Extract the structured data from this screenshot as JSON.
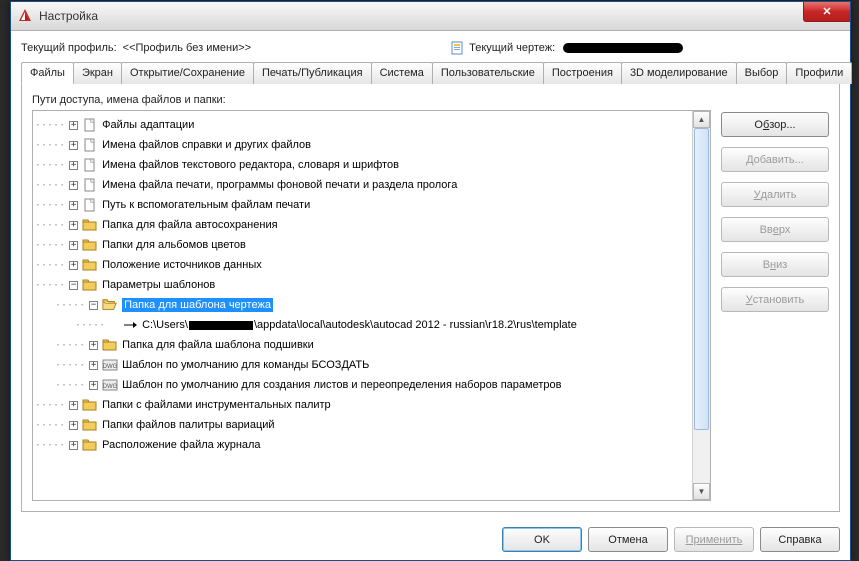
{
  "window": {
    "title": "Настройка",
    "close_x": "✕"
  },
  "profile": {
    "label": "Текущий профиль:",
    "value": "<<Профиль без имени>>",
    "drawing_label": "Текущий чертеж:"
  },
  "tabs": [
    "Файлы",
    "Экран",
    "Открытие/Сохранение",
    "Печать/Публикация",
    "Система",
    "Пользовательские",
    "Построения",
    "3D моделирование",
    "Выбор",
    "Профили"
  ],
  "active_tab_index": 0,
  "section_label": "Пути доступа, имена файлов и папки:",
  "tree": [
    {
      "indent": 0,
      "pm": "+",
      "icon": "doc",
      "label": "Файлы адаптации"
    },
    {
      "indent": 0,
      "pm": "+",
      "icon": "doc",
      "label": "Имена файлов справки и других файлов"
    },
    {
      "indent": 0,
      "pm": "+",
      "icon": "doc",
      "label": "Имена файлов текстового редактора, словаря и шрифтов"
    },
    {
      "indent": 0,
      "pm": "+",
      "icon": "doc",
      "label": "Имена файла печати, программы фоновой печати и раздела пролога"
    },
    {
      "indent": 0,
      "pm": "+",
      "icon": "doc",
      "label": "Путь к вспомогательным файлам печати"
    },
    {
      "indent": 0,
      "pm": "+",
      "icon": "folder",
      "label": "Папка для файла автосохранения"
    },
    {
      "indent": 0,
      "pm": "+",
      "icon": "folder",
      "label": "Папки для альбомов цветов"
    },
    {
      "indent": 0,
      "pm": "+",
      "icon": "folder",
      "label": "Положение источников данных"
    },
    {
      "indent": 0,
      "pm": "-",
      "icon": "folder",
      "label": "Параметры шаблонов"
    },
    {
      "indent": 1,
      "pm": "-",
      "icon": "folder-open",
      "label": "Папка для шаблона чертежа",
      "selected": true
    },
    {
      "indent": 2,
      "pm": "",
      "icon": "arrow",
      "path_prefix": "C:\\Users\\",
      "path_suffix": "\\appdata\\local\\autodesk\\autocad 2012 - russian\\r18.2\\rus\\template"
    },
    {
      "indent": 1,
      "pm": "+",
      "icon": "folder",
      "label": "Папка для файла шаблона подшивки"
    },
    {
      "indent": 1,
      "pm": "+",
      "icon": "dwg",
      "label": "Шаблон по умолчанию для команды БСОЗДАТЬ"
    },
    {
      "indent": 1,
      "pm": "+",
      "icon": "dwg",
      "label": "Шаблон по умолчанию для создания листов и переопределения наборов параметров"
    },
    {
      "indent": 0,
      "pm": "+",
      "icon": "folder",
      "label": "Папки с файлами инструментальных палитр"
    },
    {
      "indent": 0,
      "pm": "+",
      "icon": "folder",
      "label": "Папки файлов палитры вариаций"
    },
    {
      "indent": 0,
      "pm": "+",
      "icon": "folder",
      "label": "Расположение файла журнала"
    }
  ],
  "side_buttons": [
    {
      "key": "browse",
      "label": "Обзор...",
      "enabled": true,
      "u": 1
    },
    {
      "key": "add",
      "label": "Добавить...",
      "enabled": false,
      "u": 0
    },
    {
      "key": "delete",
      "label": "Удалить",
      "enabled": false,
      "u": 0
    },
    {
      "key": "up",
      "label": "Вверх",
      "enabled": false,
      "u": 2
    },
    {
      "key": "down",
      "label": "Вниз",
      "enabled": false,
      "u": 1
    },
    {
      "key": "set",
      "label": "Установить",
      "enabled": false,
      "u": 0
    }
  ],
  "bottom_buttons": {
    "ok": "OK",
    "cancel": "Отмена",
    "apply": "Применить",
    "help": "Справка"
  }
}
